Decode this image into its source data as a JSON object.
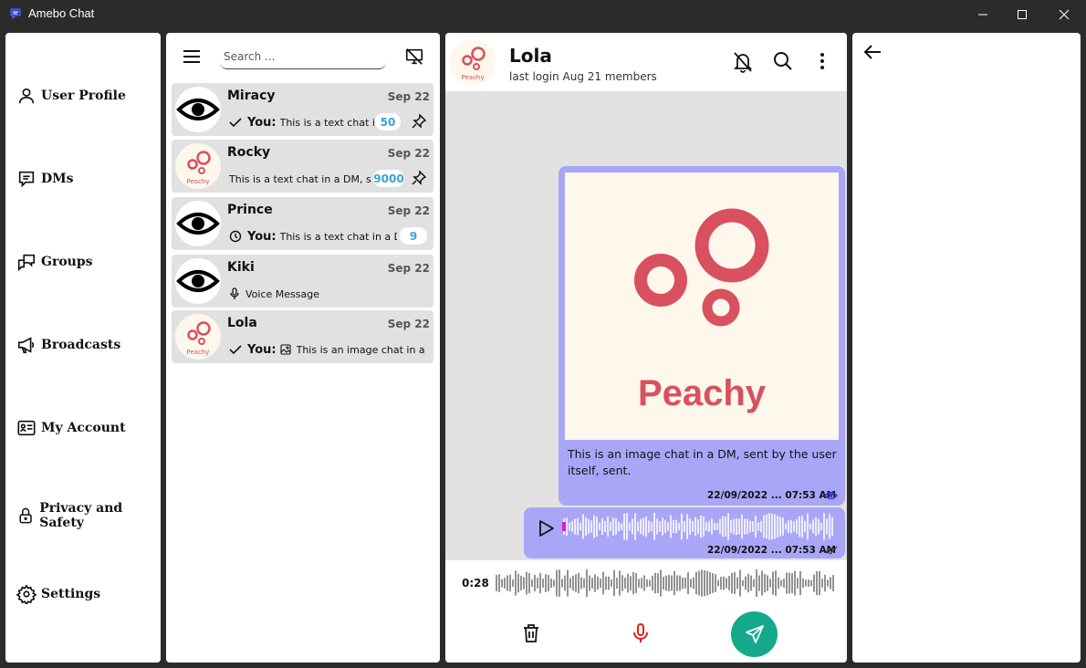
{
  "window": {
    "title": "Amebo Chat",
    "controls": [
      "minimize-icon",
      "maximize-icon",
      "close-icon"
    ]
  },
  "nav": {
    "items": [
      {
        "label": "User Profile",
        "icon": "user-icon"
      },
      {
        "label": "DMs",
        "icon": "message-icon"
      },
      {
        "label": "Groups",
        "icon": "groups-icon"
      },
      {
        "label": "Broadcasts",
        "icon": "megaphone-icon"
      },
      {
        "label": "My Account",
        "icon": "id-card-icon"
      },
      {
        "label": "Privacy and Safety",
        "icon": "lock-icon"
      },
      {
        "label": "Settings",
        "icon": "gear-icon"
      }
    ]
  },
  "chat_list": {
    "search_placeholder": "Search ...",
    "chats": [
      {
        "name": "Miracy",
        "date": "Sep 22",
        "status_icon": "check-icon",
        "you": "You:",
        "preview": "This is a text chat in",
        "badge": "50",
        "pinned": true,
        "avatar": "eye-icon"
      },
      {
        "name": "Rocky",
        "date": "Sep 22",
        "status_icon": "",
        "you": "",
        "preview": "This is a text chat in a DM, sent",
        "badge": "9000",
        "pinned": true,
        "avatar": "peachy-logo"
      },
      {
        "name": "Prince",
        "date": "Sep 22",
        "status_icon": "clock-icon",
        "you": "You:",
        "preview": "This is a text chat in a DM",
        "badge": "9",
        "pinned": false,
        "avatar": "eye-icon"
      },
      {
        "name": "Kiki",
        "date": "Sep 22",
        "status_icon": "mic-icon",
        "you": "",
        "preview": "Voice Message",
        "badge": "",
        "pinned": false,
        "avatar": "eye-icon"
      },
      {
        "name": "Lola",
        "date": "Sep 22",
        "status_icon": "check-icon",
        "you": "You:",
        "preview": "This is an image chat in a DM",
        "badge": "",
        "pinned": false,
        "avatar": "peachy-logo"
      }
    ]
  },
  "conversation": {
    "name": "Lola",
    "subtitle": "last login Aug 21 members",
    "messages": [
      {
        "type": "image",
        "image_text": "Peachy",
        "caption": "This is an image chat in a DM, sent by the user itself, sent.",
        "timestamp": "22/09/2022 ... 07:53 AM",
        "status_icon": "eye-icon"
      },
      {
        "type": "voice",
        "timestamp": "22/09/2022 ... 07:53 AM",
        "status_icon": "double-check-icon"
      }
    ],
    "composer": {
      "recording_time": "0:28"
    }
  },
  "avatar_logo_text": "Peachy",
  "colors": {
    "bubble": "#a9a6f8",
    "send": "#13a98a",
    "peach": "#d9505f",
    "badge_text": "#3aa0d8",
    "mic": "#e0201a"
  }
}
